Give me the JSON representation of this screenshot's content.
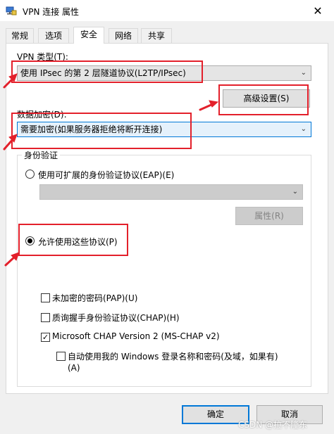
{
  "window": {
    "title": "VPN 连接 属性",
    "close_glyph": "✕"
  },
  "tabs": [
    {
      "label": "常规",
      "active": false
    },
    {
      "label": "选项",
      "active": false
    },
    {
      "label": "安全",
      "active": true
    },
    {
      "label": "网络",
      "active": false
    },
    {
      "label": "共享",
      "active": false
    }
  ],
  "security": {
    "vpn_type_label": "VPN 类型(T):",
    "vpn_type_value": "使用 IPsec 的第 2 层隧道协议(L2TP/IPsec)",
    "advanced_button": "高级设置(S)",
    "encryption_label": "数据加密(D):",
    "encryption_value": "需要加密(如果服务器拒绝将断开连接)",
    "auth_group_label": "身份验证",
    "eap_radio_label": "使用可扩展的身份验证协议(EAP)(E)",
    "eap_combo_value": "",
    "eap_properties_button": "属性(R)",
    "allow_protocols_radio_label": "允许使用这些协议(P)",
    "protocols": [
      {
        "label": "未加密的密码(PAP)(U)",
        "checked": false
      },
      {
        "label": "质询握手身份验证协议(CHAP)(H)",
        "checked": false
      },
      {
        "label": "Microsoft CHAP Version 2 (MS-CHAP v2)",
        "checked": true
      }
    ],
    "auto_windows_logon_line1": "自动使用我的 Windows 登录名称和密码(及域，如果有)",
    "auto_windows_logon_line2": "(A)",
    "auto_windows_logon_checked": false
  },
  "footer": {
    "ok_button": "确定",
    "cancel_button": "取消"
  },
  "watermark": "CSDN @拉不隆东",
  "colors": {
    "annotation_red": "#e3202b",
    "accent_blue": "#0078d7",
    "panel_bg": "#f0f0f0"
  }
}
